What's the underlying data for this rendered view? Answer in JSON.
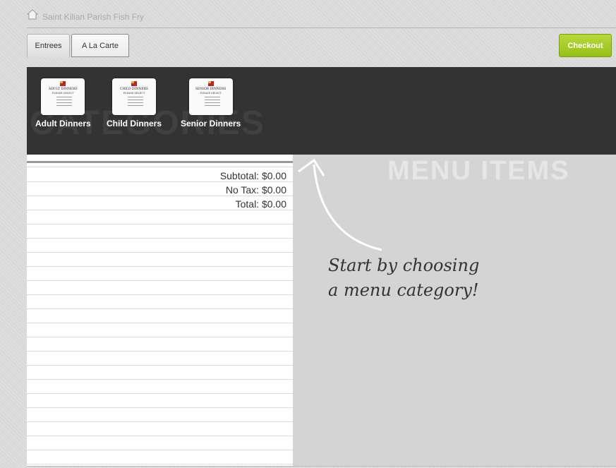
{
  "header": {
    "title": "Saint Kilian Parish Fish Fry",
    "icon": "home-icon"
  },
  "tabs": [
    {
      "label": "Entrees"
    },
    {
      "label": "A La Carte"
    }
  ],
  "checkout": {
    "label": "Checkout",
    "color": "#9cc51e"
  },
  "categories": {
    "watermark": "CATEGORIES",
    "items": [
      {
        "label": "Adult Dinners",
        "card_title": "ADULT DINNERS",
        "card_subtitle": "PLEASE SELECT"
      },
      {
        "label": "Child Dinners",
        "card_title": "CHILD DINNERS",
        "card_subtitle": "PLEASE SELECT"
      },
      {
        "label": "Senior Dinners",
        "card_title": "SENIOR DINNERS",
        "card_subtitle": "PLEASE SELECT"
      }
    ]
  },
  "order": {
    "subtotal": "Subtotal: $0.00",
    "tax": "No Tax: $0.00",
    "total": "Total: $0.00"
  },
  "menu": {
    "watermark": "MENU ITEMS",
    "hint_line1": "Start by choosing",
    "hint_line2": "a menu category!"
  }
}
